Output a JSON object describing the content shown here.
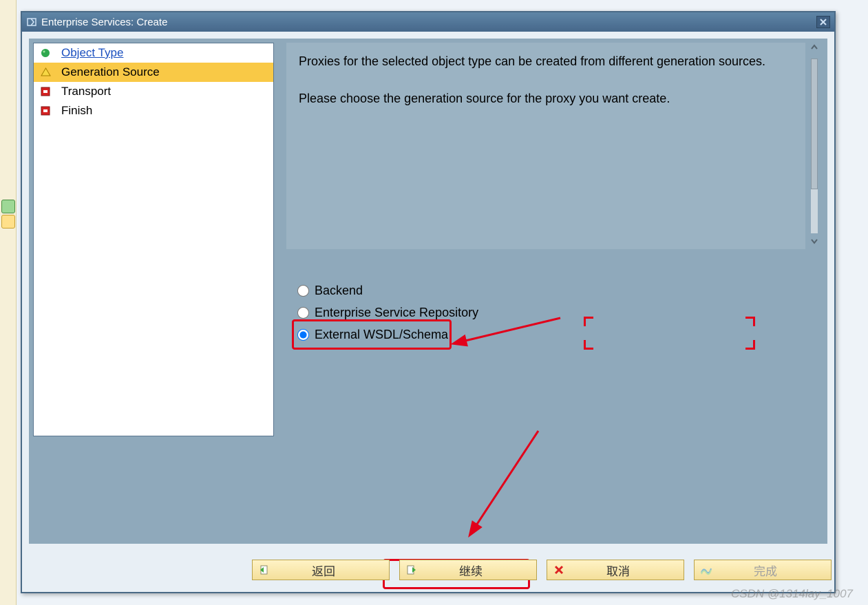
{
  "titlebar": {
    "title": "Enterprise Services: Create"
  },
  "steps": [
    {
      "label": "Object Type",
      "status": "done"
    },
    {
      "label": "Generation Source",
      "status": "current"
    },
    {
      "label": "Transport",
      "status": "pending"
    },
    {
      "label": "Finish",
      "status": "pending"
    }
  ],
  "description": {
    "line1": "Proxies for the selected object type can be created from different generation sources.",
    "line2": "Please choose the generation source for the proxy you want create."
  },
  "radios": {
    "backend": "Backend",
    "esr": "Enterprise Service Repository",
    "wsdl": "External WSDL/Schema",
    "selected": "wsdl"
  },
  "buttons": {
    "back": "返回",
    "continue": "继续",
    "cancel": "取消",
    "finish": "完成"
  },
  "watermark": "CSDN @1314lay_1007"
}
